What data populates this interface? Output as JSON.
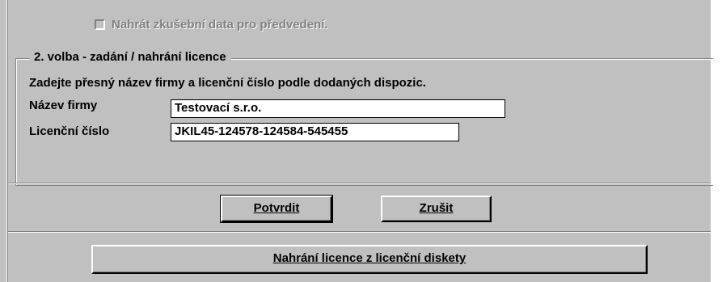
{
  "demo": {
    "label": "Nahrát zkušební data pro předvedení."
  },
  "license_group": {
    "title": "2. volba - zadání / nahrání licence",
    "instruction": "Zadejte přesný název firmy a licenční číslo podle dodaných dispozic.",
    "company_label": "Název firmy",
    "company_value": "Testovací s.r.o.",
    "license_label": "Licenční číslo",
    "license_value": "JKIL45-124578-124584-545455"
  },
  "buttons": {
    "confirm": "Potvrdit",
    "cancel": "Zrušit",
    "load_from_disk": "Nahrání licence z licenční diskety"
  }
}
